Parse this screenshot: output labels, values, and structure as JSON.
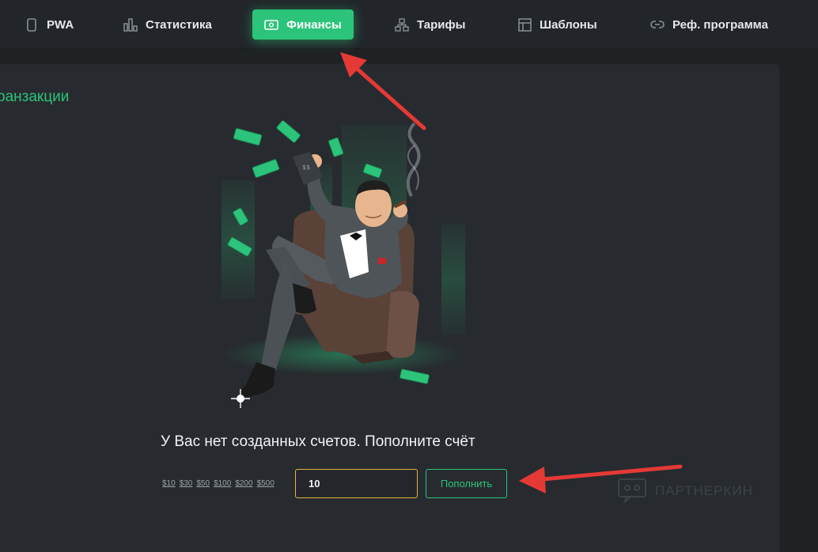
{
  "nav": {
    "items": [
      {
        "label": "PWA",
        "icon": "phone-icon"
      },
      {
        "label": "Статистика",
        "icon": "bar-chart-icon"
      },
      {
        "label": "Финансы",
        "icon": "money-icon",
        "active": true
      },
      {
        "label": "Тарифы",
        "icon": "hierarchy-icon"
      },
      {
        "label": "Шаблоны",
        "icon": "template-icon"
      },
      {
        "label": "Реф. программа",
        "icon": "link-icon"
      }
    ]
  },
  "main": {
    "section_title": "ранзакции",
    "empty_message": "У Вас нет созданных счетов. Пополните счёт",
    "quick_amounts": [
      "$10",
      "$30",
      "$50",
      "$100",
      "$200",
      "$500"
    ],
    "amount_value": "10",
    "topup_label": "Пополнить"
  },
  "watermark": {
    "text": "ПАРТНЕРКИН"
  },
  "colors": {
    "accent": "#2bc47a",
    "background": "#1f2225",
    "card": "#272b2f",
    "input_border": "#e2b43f",
    "arrow": "#e53935"
  }
}
